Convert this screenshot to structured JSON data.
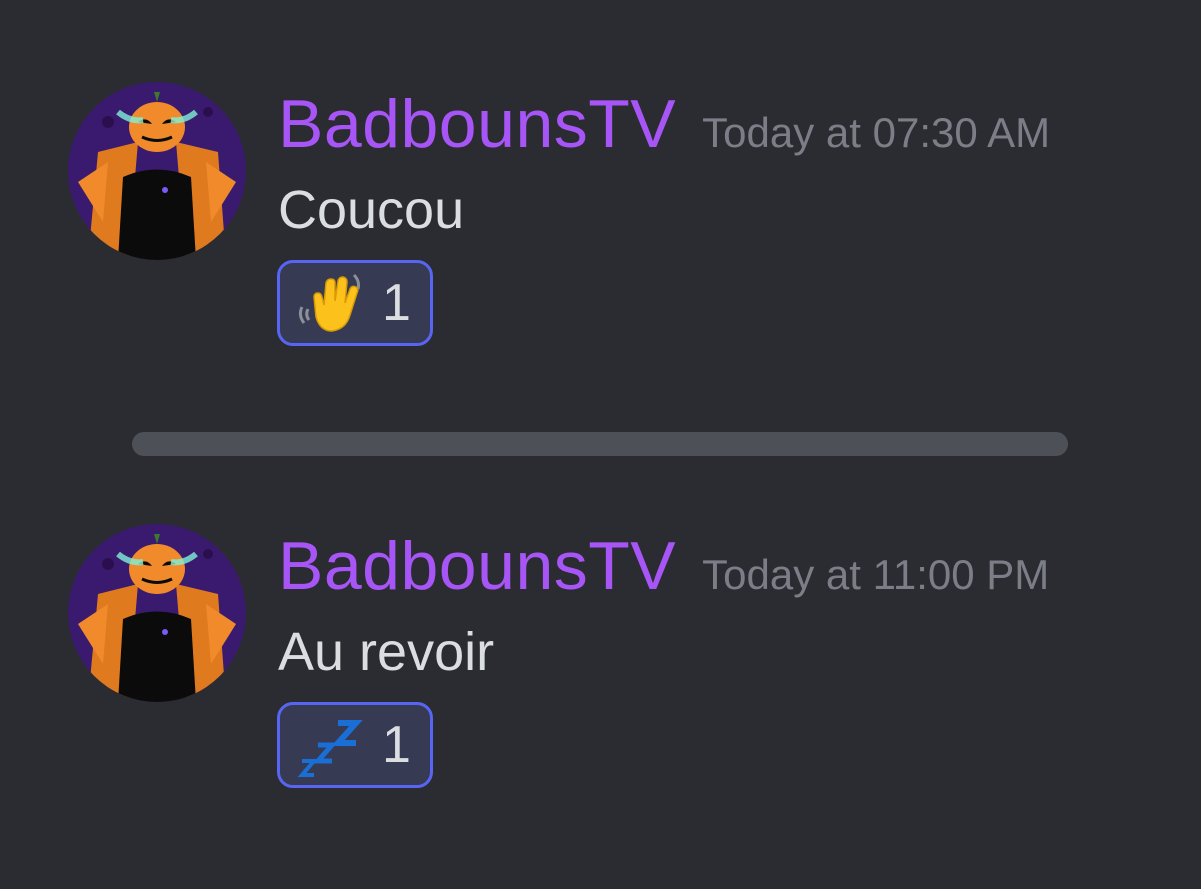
{
  "messages": [
    {
      "username": "BadbounsTV",
      "timestamp": "Today at 07:30 AM",
      "content": "Coucou",
      "reaction": {
        "emoji_icon": "waving-hand-icon",
        "count": "1"
      }
    },
    {
      "username": "BadbounsTV",
      "timestamp": "Today at 11:00 PM",
      "content": "Au revoir",
      "reaction": {
        "emoji_icon": "zzz-sleeping-icon",
        "count": "1"
      }
    }
  ],
  "colors": {
    "background": "#2b2c31",
    "username": "#a855f7",
    "timestamp": "#7b7e87",
    "message_text": "#dbdee1",
    "reaction_border": "#5865f2",
    "reaction_background": "#373a53",
    "divider": "#4e5058"
  }
}
